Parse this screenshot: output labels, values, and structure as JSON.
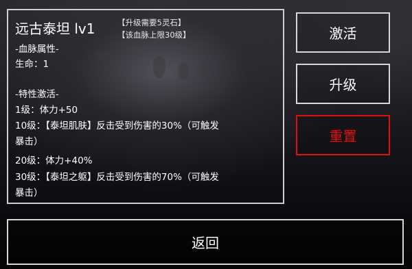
{
  "bloodline": {
    "title": "远古泰坦  lv1",
    "upgrade_cost_note": "【升级需要5灵石】",
    "level_cap_note": "【该血脉上限30级】",
    "attributes_header": "-血脉属性-",
    "life": "生命：1",
    "traits_header": "-特性激活-",
    "trait_lines": [
      "1级：体力+50",
      "10级：【泰坦肌肤】反击受到伤害的30%（可触发",
      "暴击）",
      "20级：体力+40%",
      "30级：【泰坦之躯】反击受到伤害的70%（可触发",
      "暴击）"
    ]
  },
  "buttons": {
    "activate": "激活",
    "upgrade": "升级",
    "reset": "重置",
    "back": "返回"
  },
  "colors": {
    "reset_accent": "#e01010",
    "border": "#d8d8d8"
  }
}
